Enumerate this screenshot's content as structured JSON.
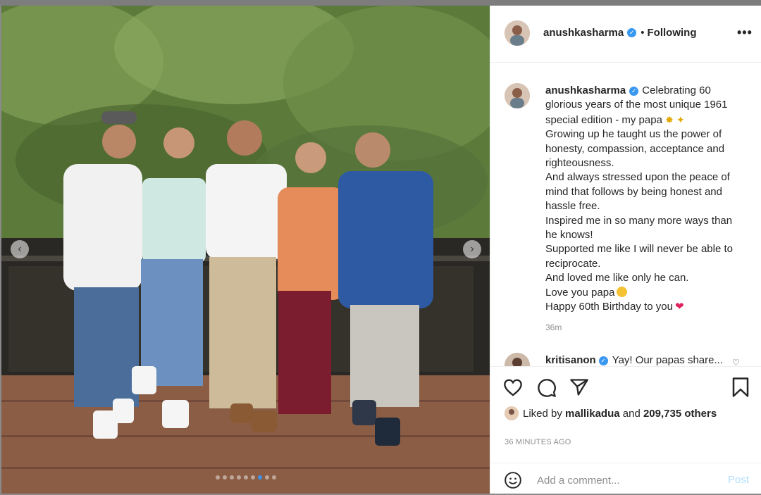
{
  "post": {
    "username": "anushkasharma",
    "verified": true,
    "follow_status": "Following",
    "separator": "•",
    "caption": {
      "line1": "Celebrating 60 glorious years of the most unique 1961 special edition - my papa",
      "line2": "Growing up he taught us the power of honesty, compassion, acceptance and righteousness.",
      "line3": "And always stressed upon the peace of mind that follows by being honest and hassle free.",
      "line4": "Inspired me in so many more ways than he knows!",
      "line5": "Supported me like I will never be able to reciprocate.",
      "line6": "And loved me like only he can.",
      "line7": "Love you papa",
      "line8": "Happy 60th Birthday to you"
    },
    "caption_age": "36m",
    "next_comment": {
      "username": "kritisanon",
      "text": "Yay! Our papas share..."
    },
    "liked_by_prefix": "Liked by",
    "liked_by_user": "mallikadua",
    "liked_by_and": "and",
    "likes_others": "209,735 others",
    "posted_ago": "36 MINUTES AGO",
    "comment_placeholder": "Add a comment...",
    "post_label": "Post"
  },
  "carousel": {
    "total_slides": 9,
    "active_slide": 7,
    "prev_glyph": "‹",
    "next_glyph": "›"
  },
  "icons": {
    "like": "heart-outline-icon",
    "comment": "speech-bubble-icon",
    "share": "paper-plane-icon",
    "save": "bookmark-icon",
    "more": "more-options-icon",
    "emoji": "smiley-icon"
  },
  "colors": {
    "verified_blue": "#3897f0",
    "post_button_disabled": "#b2dffc",
    "heart_red": "#e0245e",
    "carousel_active_dot": "#3b95f0"
  }
}
